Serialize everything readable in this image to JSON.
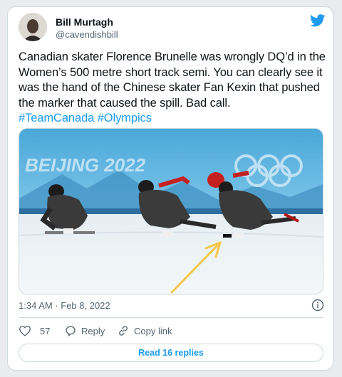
{
  "tweet": {
    "author_name": "Bill Murtagh",
    "author_handle": "@cavendishbill",
    "text": "Canadian skater Florence Brunelle was wrongly DQ’d in the Women’s 500 metre short track semi. You can clearly see it was the hand of the Chinese skater Fan Kexin that pushed the marker that caused the spill. Bad call.",
    "hashtags": [
      "#TeamCanada",
      "#Olympics"
    ],
    "timestamp": "1:34 AM · Feb 8, 2022",
    "likes": "57",
    "reply_label": "Reply",
    "copy_link_label": "Copy link",
    "read_replies_label": "Read 16 replies"
  },
  "media": {
    "signage_text": "BEIJING 2022"
  },
  "colors": {
    "link": "#1d9bf0",
    "secondary_text": "#536471",
    "border": "#cfd9de",
    "arrow": "#f3c84a"
  },
  "icons": {
    "brand": "twitter-bird-icon",
    "info": "info-icon",
    "like": "heart-icon",
    "reply": "reply-bubble-icon",
    "copy_link": "link-icon"
  }
}
